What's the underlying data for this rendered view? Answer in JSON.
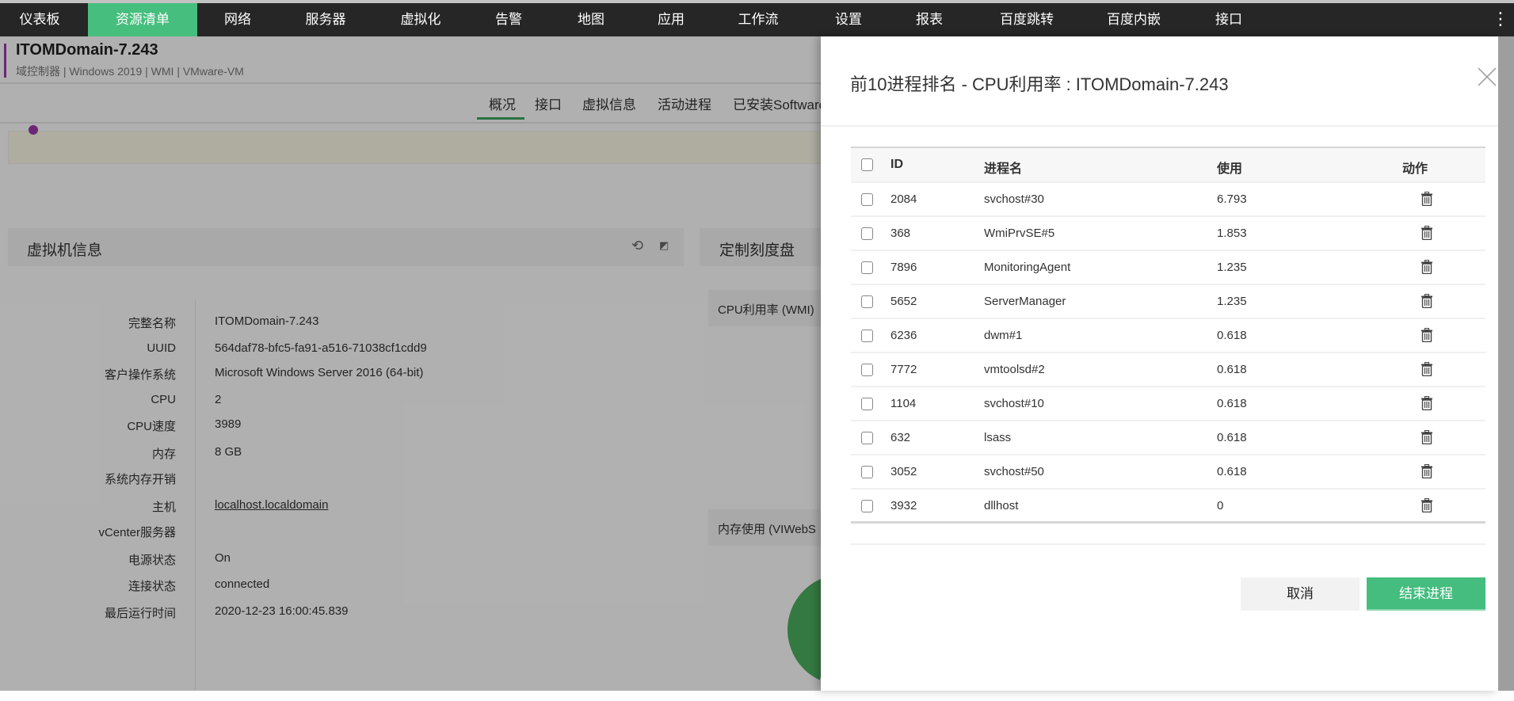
{
  "nav": {
    "items": [
      "仪表板",
      "资源清单",
      "网络",
      "服务器",
      "虚拟化",
      "告警",
      "地图",
      "应用",
      "工作流",
      "设置",
      "报表",
      "百度跳转",
      "百度内嵌",
      "接口"
    ],
    "active": "资源清单",
    "more_icon": "⋮"
  },
  "device": {
    "title": "ITOMDomain-7.243",
    "subtitle": "域控制器 | Windows 2019  | WMI  | VMware-VM"
  },
  "tabs": [
    "概况",
    "接口",
    "虚拟信息",
    "活动进程",
    "已安装Software"
  ],
  "vm_info": {
    "title": "虚拟机信息",
    "rows": [
      {
        "label": "完整名称",
        "value": "ITOMDomain-7.243"
      },
      {
        "label": "UUID",
        "value": "564daf78-bfc5-fa91-a516-71038cf1cdd9"
      },
      {
        "label": "客户操作系统",
        "value": "Microsoft Windows Server 2016 (64-bit)"
      },
      {
        "label": "CPU",
        "value": "2"
      },
      {
        "label": "CPU速度",
        "value": "3989"
      },
      {
        "label": "内存",
        "value": "8 GB"
      },
      {
        "label": "系统内存开销",
        "value": ""
      },
      {
        "label": "主机",
        "value": "localhost.localdomain"
      },
      {
        "label": "vCenter服务器",
        "value": ""
      },
      {
        "label": "电源状态",
        "value": "On"
      },
      {
        "label": "连接状态",
        "value": "connected"
      },
      {
        "label": "最后运行时间",
        "value": "2020-12-23 16:00:45.839"
      }
    ]
  },
  "dashboard": {
    "title": "定制刻度盘",
    "cpu_widget": "CPU利用率 (WMI)",
    "mem_widget": "内存使用 (VIWebS"
  },
  "panel": {
    "title": "前10进程排名 - CPU利用率 : ITOMDomain-7.243",
    "columns": {
      "id": "ID",
      "name": "进程名",
      "usage": "使用",
      "action": "动作"
    },
    "rows": [
      {
        "id": "2084",
        "name": "svchost#30",
        "usage": "6.793"
      },
      {
        "id": "368",
        "name": "WmiPrvSE#5",
        "usage": "1.853"
      },
      {
        "id": "7896",
        "name": "MonitoringAgent",
        "usage": "1.235"
      },
      {
        "id": "5652",
        "name": "ServerManager",
        "usage": "1.235"
      },
      {
        "id": "6236",
        "name": "dwm#1",
        "usage": "0.618"
      },
      {
        "id": "7772",
        "name": "vmtoolsd#2",
        "usage": "0.618"
      },
      {
        "id": "1104",
        "name": "svchost#10",
        "usage": "0.618"
      },
      {
        "id": "632",
        "name": "lsass",
        "usage": "0.618"
      },
      {
        "id": "3052",
        "name": "svchost#50",
        "usage": "0.618"
      },
      {
        "id": "3932",
        "name": "dllhost",
        "usage": "0"
      }
    ],
    "cancel_label": "取消",
    "kill_label": "结束进程"
  },
  "colors": {
    "accent": "#44bd7e",
    "nav_bg": "#262626",
    "tag": "#9b3aa8"
  }
}
